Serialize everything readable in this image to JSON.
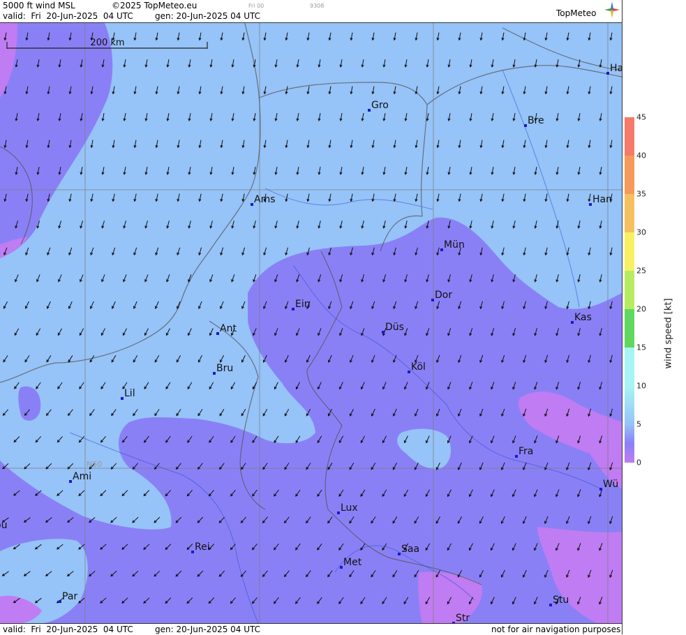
{
  "header": {
    "product": "5000 ft wind MSL",
    "copyright": "©2025 TopMeteo.eu",
    "small_run": "Fri 00",
    "small_code": "9308",
    "valid": "valid:  Fri  20-Jun-2025  04 UTC",
    "gen": "gen: 20-Jun-2025 04 UTC",
    "logo": "TopMeteo"
  },
  "footer": {
    "valid": "valid:  Fri  20-Jun-2025  04 UTC",
    "gen": "gen: 20-Jun-2025 04 UTC",
    "disclaimer": "not for air navigation purposes"
  },
  "map": {
    "scale_bar": "200 km",
    "lat_label": "N50",
    "cities": [
      {
        "name": "Ha"
      },
      {
        "name": "Gro"
      },
      {
        "name": "Bre"
      },
      {
        "name": "Ams"
      },
      {
        "name": "Han"
      },
      {
        "name": "Mün"
      },
      {
        "name": "Dor"
      },
      {
        "name": "Ein"
      },
      {
        "name": "Kas"
      },
      {
        "name": "Ant"
      },
      {
        "name": "Düs"
      },
      {
        "name": "Bru"
      },
      {
        "name": "Köl"
      },
      {
        "name": "Lil"
      },
      {
        "name": "Fra"
      },
      {
        "name": "Ami"
      },
      {
        "name": "Wü"
      },
      {
        "name": "Lux"
      },
      {
        "name": "ou"
      },
      {
        "name": "Rei"
      },
      {
        "name": "Saa"
      },
      {
        "name": "Met"
      },
      {
        "name": "Par"
      },
      {
        "name": "Stu"
      },
      {
        "name": "Str"
      }
    ],
    "wind_direction_note": "arrows point south / southwest",
    "colors": {
      "light_blue": "#96c3f8",
      "purple": "#8a80f6",
      "violet": "#c07cf2",
      "city_marker": "#1a1ad0"
    }
  },
  "legend": {
    "title": "wind speed [kt]",
    "ticks": [
      "45",
      "40",
      "35",
      "30",
      "25",
      "20",
      "15",
      "10",
      "5",
      "0"
    ],
    "colors": [
      "#f57a6a",
      "#f59a5a",
      "#f6c060",
      "#f8f060",
      "#b8ec60",
      "#60d860",
      "#a8f4f4",
      "#96c3f8",
      "#8a80f6",
      "#c07cf2"
    ]
  }
}
